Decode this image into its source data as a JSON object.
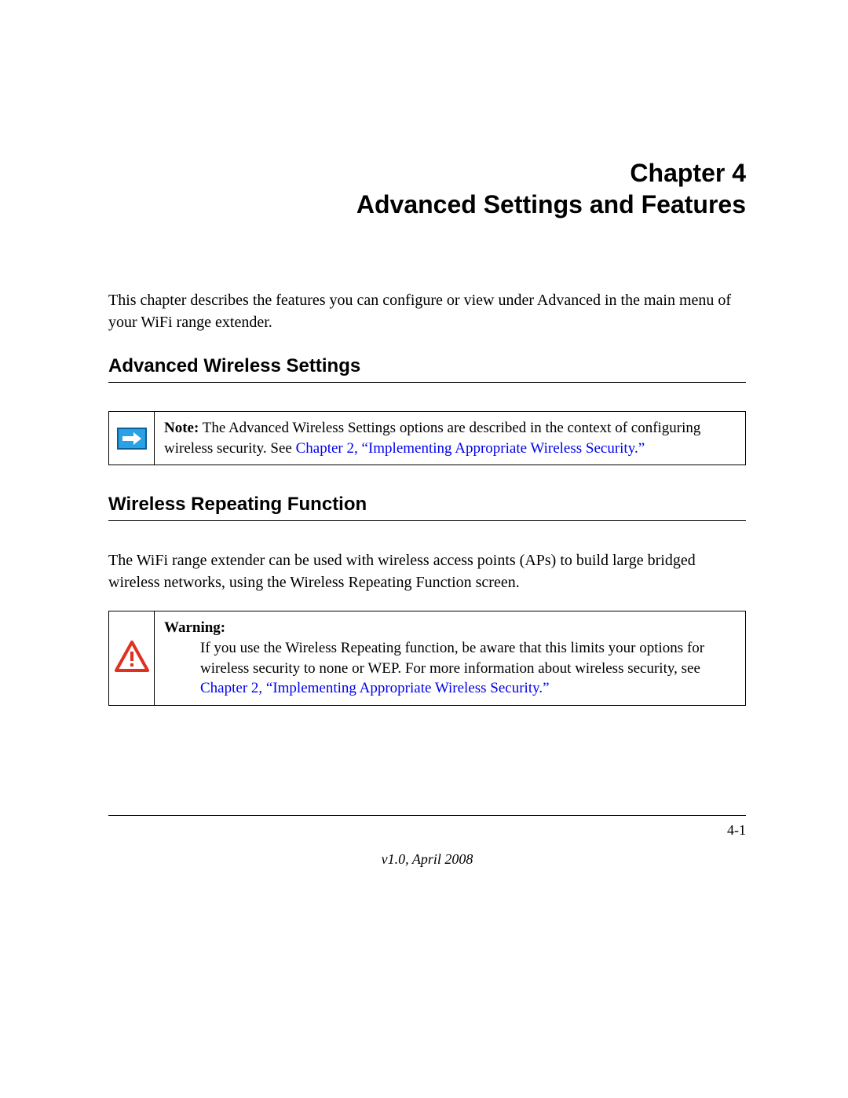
{
  "chapter": {
    "line1": "Chapter 4",
    "line2": "Advanced Settings and Features"
  },
  "intro": "This chapter describes the features you can configure or view under Advanced in the main menu of your WiFi range extender.",
  "sections": {
    "advancedWireless": {
      "heading": "Advanced Wireless Settings",
      "note": {
        "label": "Note:",
        "text_before_link": " The Advanced Wireless Settings options are described in the context of configuring wireless security. See ",
        "link_text": "Chapter 2, “Implementing Appropriate Wireless Security.”"
      }
    },
    "wirelessRepeating": {
      "heading": "Wireless Repeating Function",
      "body": "The WiFi range extender can be used with wireless access points (APs) to build large bridged wireless networks, using the Wireless Repeating Function screen.",
      "warning": {
        "label": "Warning:",
        "text_before_link": " If you use the Wireless Repeating function, be aware that this limits your options for wireless security to none or WEP. For more information about wireless security, see ",
        "link_text": "Chapter 2, “Implementing Appropriate Wireless Security.”"
      }
    }
  },
  "footer": {
    "page": "4-1",
    "version": "v1.0, April 2008"
  }
}
